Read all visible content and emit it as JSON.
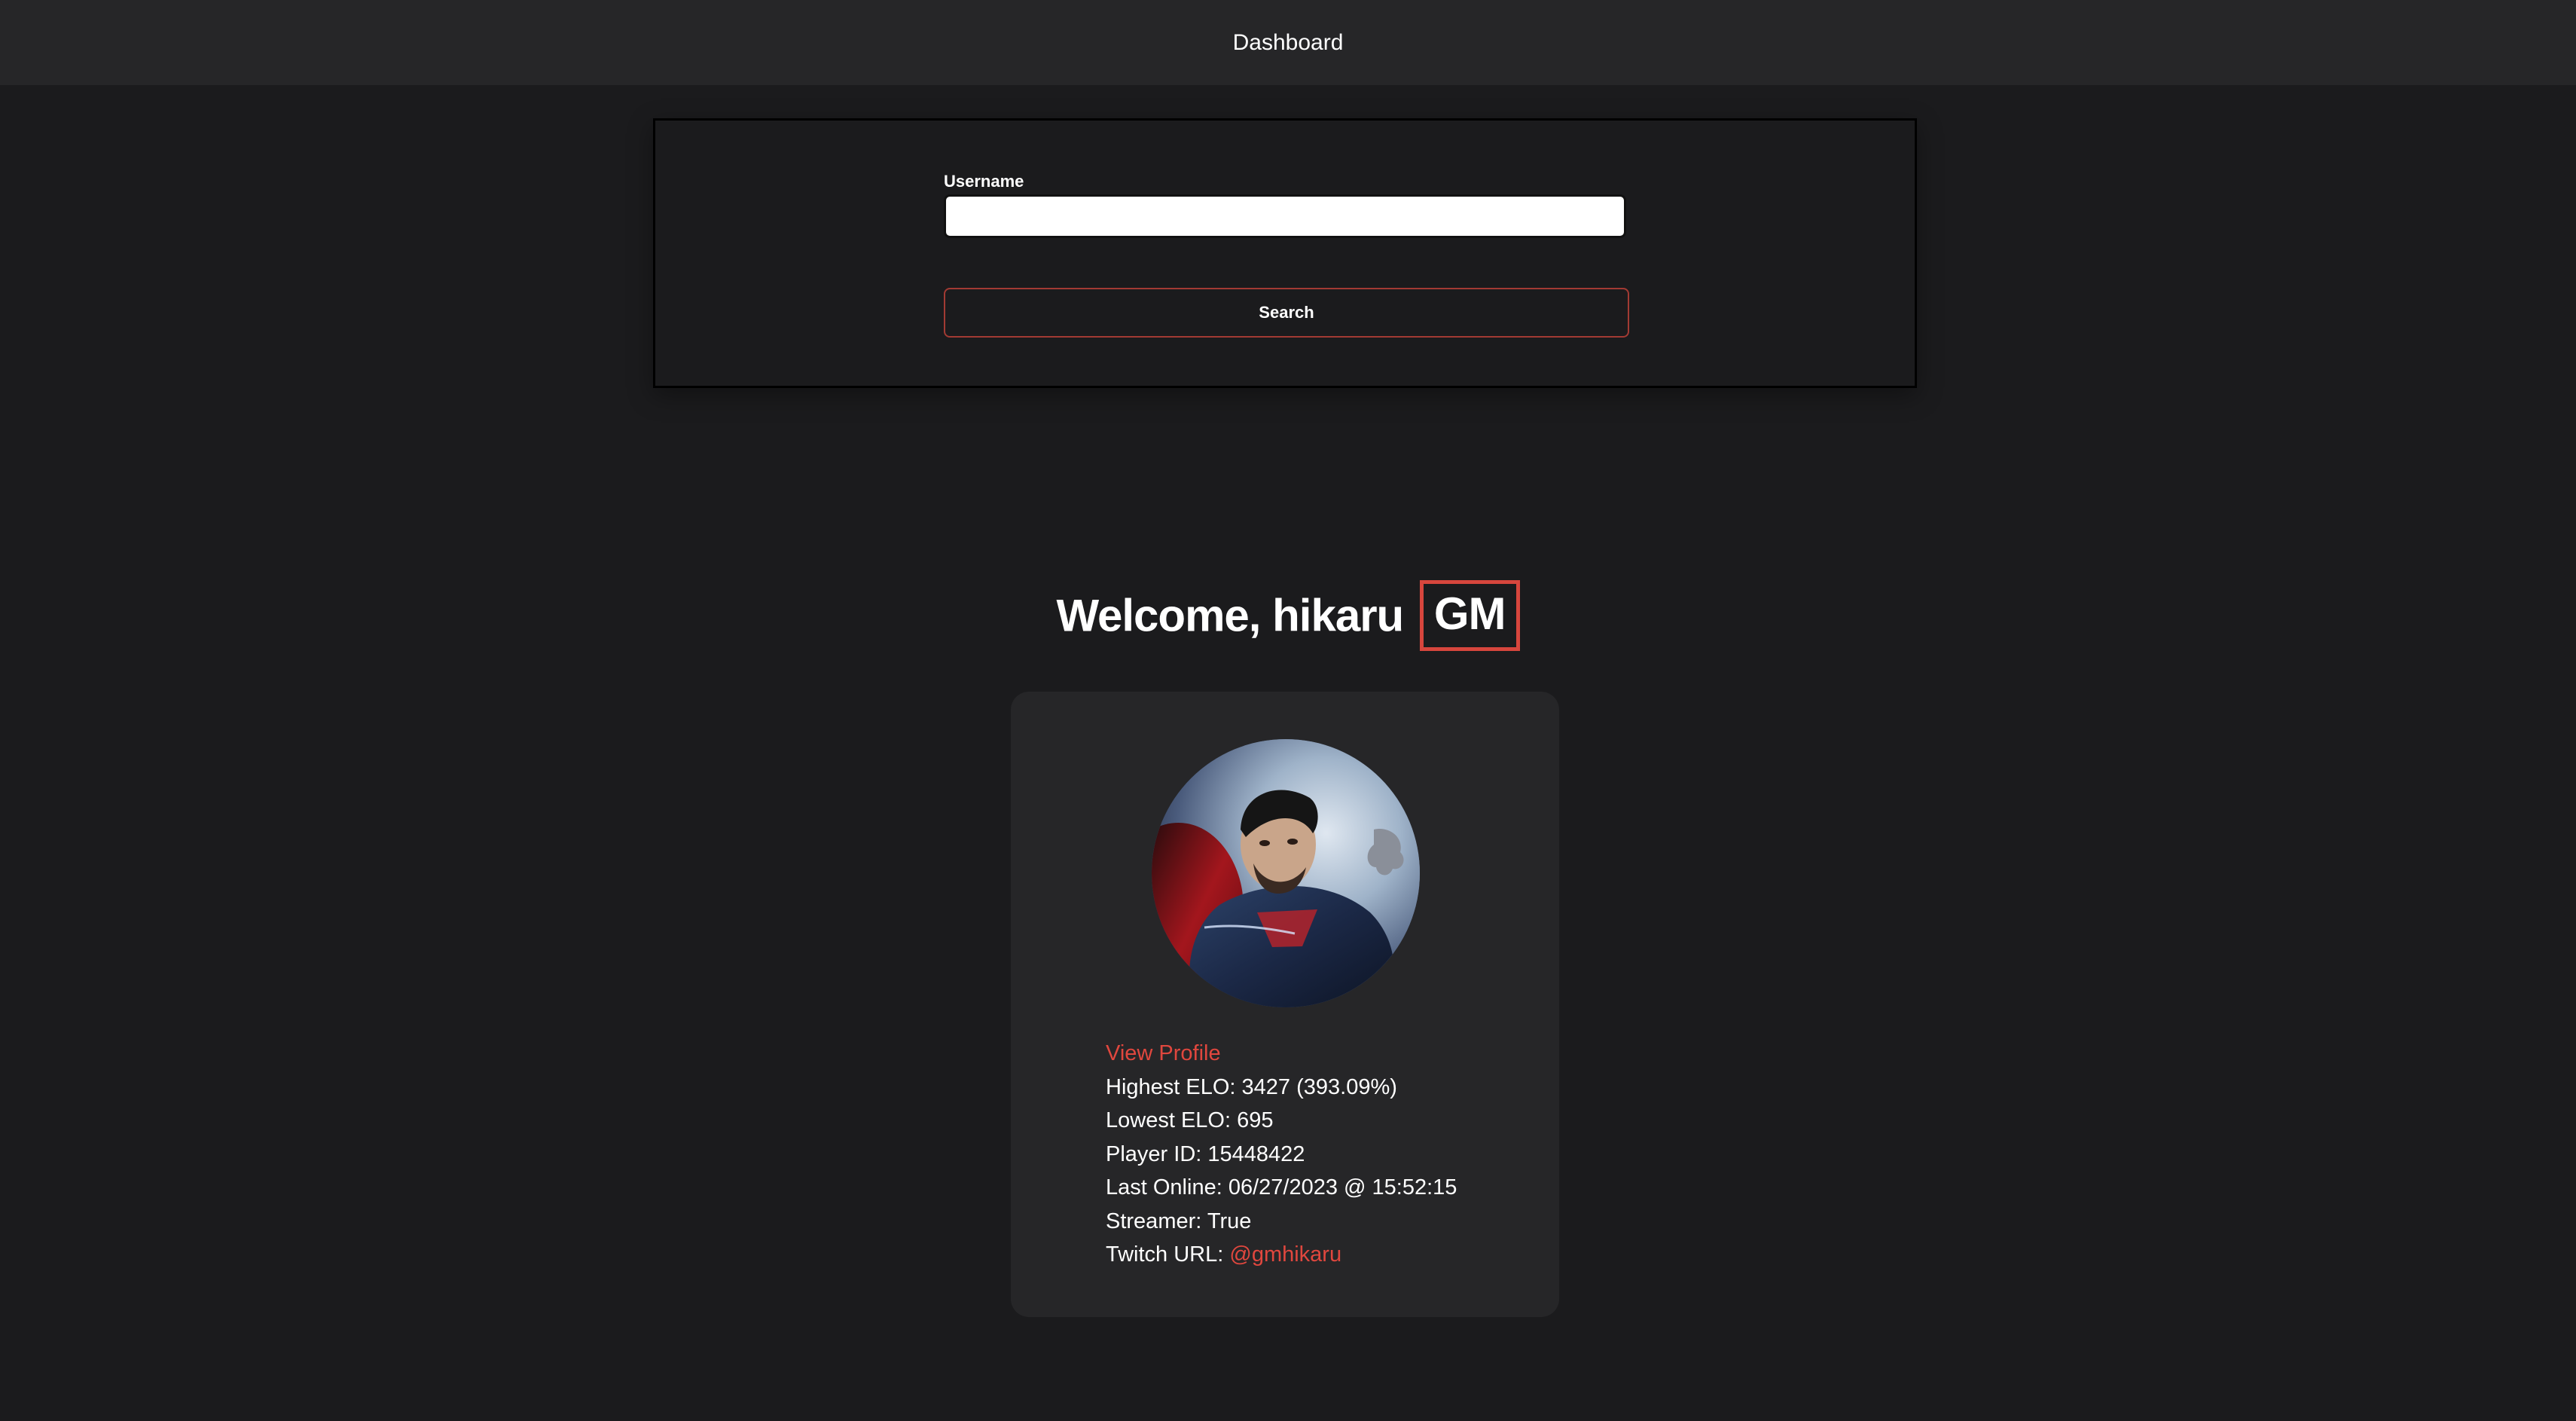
{
  "header": {
    "title": "Dashboard"
  },
  "search": {
    "label": "Username",
    "value": "",
    "placeholder": "",
    "button_label": "Search"
  },
  "welcome": {
    "greeting": "Welcome,",
    "username": "hikaru",
    "title_badge": "GM"
  },
  "profile": {
    "view_profile_label": "View Profile",
    "highest_elo": "Highest ELO: 3427 (393.09%)",
    "lowest_elo": "Lowest ELO: 695",
    "player_id": "Player ID: 15448422",
    "last_online": "Last Online: 06/27/2023 @ 15:52:15",
    "streamer": "Streamer: True",
    "twitch_label": "Twitch URL: ",
    "twitch_handle": "@gmhikaru"
  },
  "colors": {
    "background": "#1b1b1d",
    "topbar": "#262628",
    "card": "#262628",
    "accent": "#e0473e",
    "search_border": "#a23a33"
  },
  "icons": {
    "avatar": "player-avatar-superhero"
  }
}
